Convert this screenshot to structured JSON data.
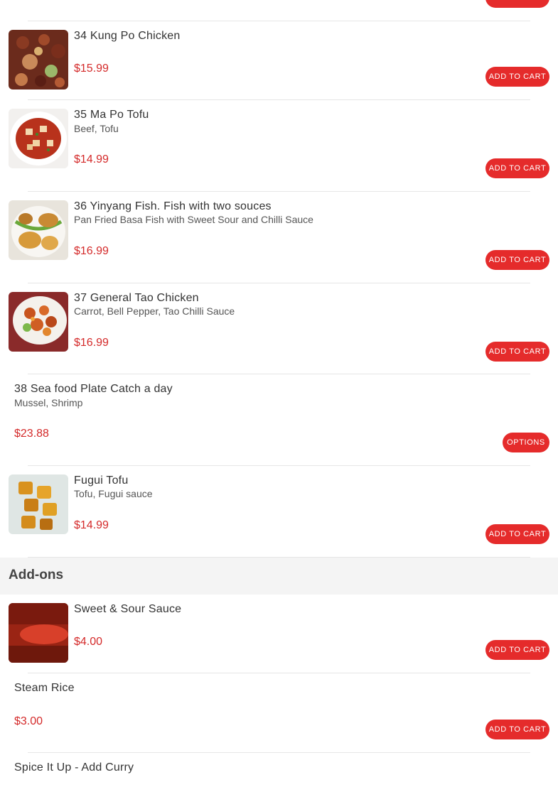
{
  "colors": {
    "accent": "#e52b2b",
    "price": "#d42a2a",
    "section_bg": "#f4f4f4"
  },
  "buttons": {
    "add_to_cart": "ADD TO CART",
    "options": "OPTIONS"
  },
  "items": [
    {
      "name": "34 Kung Po Chicken",
      "description": "",
      "price": "$15.99",
      "image": "kung-po-chicken-image",
      "button": "ADD TO CART"
    },
    {
      "name": "35 Ma Po Tofu",
      "description": "Beef, Tofu",
      "price": "$14.99",
      "image": "ma-po-tofu-image",
      "button": "ADD TO CART"
    },
    {
      "name": "36 Yinyang Fish. Fish with two souces",
      "description": "Pan Fried Basa Fish with Sweet Sour and Chilli Sauce",
      "price": "$16.99",
      "image": "yinyang-fish-image",
      "button": "ADD TO CART"
    },
    {
      "name": "37 General Tao Chicken",
      "description": "Carrot, Bell Pepper, Tao Chilli Sauce",
      "price": "$16.99",
      "image": "general-tao-chicken-image",
      "button": "ADD TO CART"
    },
    {
      "name": "38 Sea food Plate Catch a day",
      "description": "Mussel, Shrimp",
      "price": "$23.88",
      "image": "",
      "button": "OPTIONS"
    },
    {
      "name": "Fugui Tofu",
      "description": "Tofu, Fugui sauce",
      "price": "$14.99",
      "image": "fugui-tofu-image",
      "button": "ADD TO CART"
    }
  ],
  "addons": {
    "title": "Add-ons",
    "items": [
      {
        "name": "Sweet & Sour Sauce",
        "price": "$4.00",
        "image": "sweet-sour-sauce-image",
        "button": "ADD TO CART"
      },
      {
        "name": "Steam Rice",
        "price": "$3.00",
        "image": "",
        "button": "ADD TO CART"
      },
      {
        "name": "Spice It Up - Add Curry",
        "price": "",
        "image": "",
        "button": ""
      }
    ]
  }
}
